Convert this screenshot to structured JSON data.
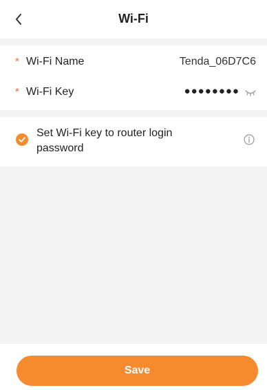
{
  "header": {
    "title": "Wi-Fi",
    "back_icon": "chevron-left-icon"
  },
  "form": {
    "wifi_name": {
      "required_mark": "*",
      "label": "Wi-Fi Name",
      "value": "Tenda_06D7C6"
    },
    "wifi_key": {
      "required_mark": "*",
      "label": "Wi-Fi Key",
      "value_masked": "●●●●●●●●",
      "toggle_icon": "eye-closed-icon"
    }
  },
  "option": {
    "label": "Set Wi-Fi key to router login password",
    "checked": true,
    "check_icon": "checkmark-icon",
    "info_icon": "info-icon"
  },
  "footer": {
    "save_label": "Save"
  },
  "colors": {
    "accent": "#f58a2e",
    "required": "#f26b2a",
    "background": "#f4f4f4",
    "card": "#ffffff"
  }
}
